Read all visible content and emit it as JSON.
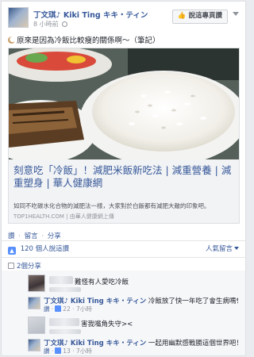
{
  "post": {
    "author": "丁文琪♪ Kiki Ting キキ・ティン",
    "time": "8 小時前",
    "page_button": "說這專頁讚",
    "text": "原來是因為冷飯比較瘦的關係啊～（筆記）"
  },
  "link": {
    "title": "刻意吃「冷飯」！減肥米飯新吃法 | 減重營養 | 減重塑身 | 華人健康網",
    "description": "如同不吃碳水化合物的減肥法一樣，大家對於白飯都有減肥大敵的印象吧。",
    "domain": "TOP1HEALTH.COM",
    "source": "由華人健康網上傳"
  },
  "actions": {
    "like": "讚",
    "comment": "留言",
    "share": "分享"
  },
  "likes": {
    "count": "120",
    "suffix": "個人說這讚",
    "top_comments": "人氣留言"
  },
  "shares": {
    "text": "2個分享"
  },
  "comments": [
    {
      "text": "難怪有人愛吃冷飯"
    },
    {
      "author": "丁文琪♪ Kiki Ting キキ・ティン",
      "text": "冷飯放了快一年吃了會生病嗎！",
      "action": "讚",
      "likes": "22",
      "time": "7小時"
    },
    {
      "text": "害我嘴角失守><"
    },
    {
      "author": "丁文琪♪ Kiki Ting キキ・ティン",
      "text": "一起用幽默感戰勝這個世界吧！",
      "action": "讚",
      "likes": "13",
      "time": "7小時"
    }
  ],
  "colors": {
    "link": "#365899",
    "muted": "#90949c",
    "like_blue": "#5890ff"
  }
}
